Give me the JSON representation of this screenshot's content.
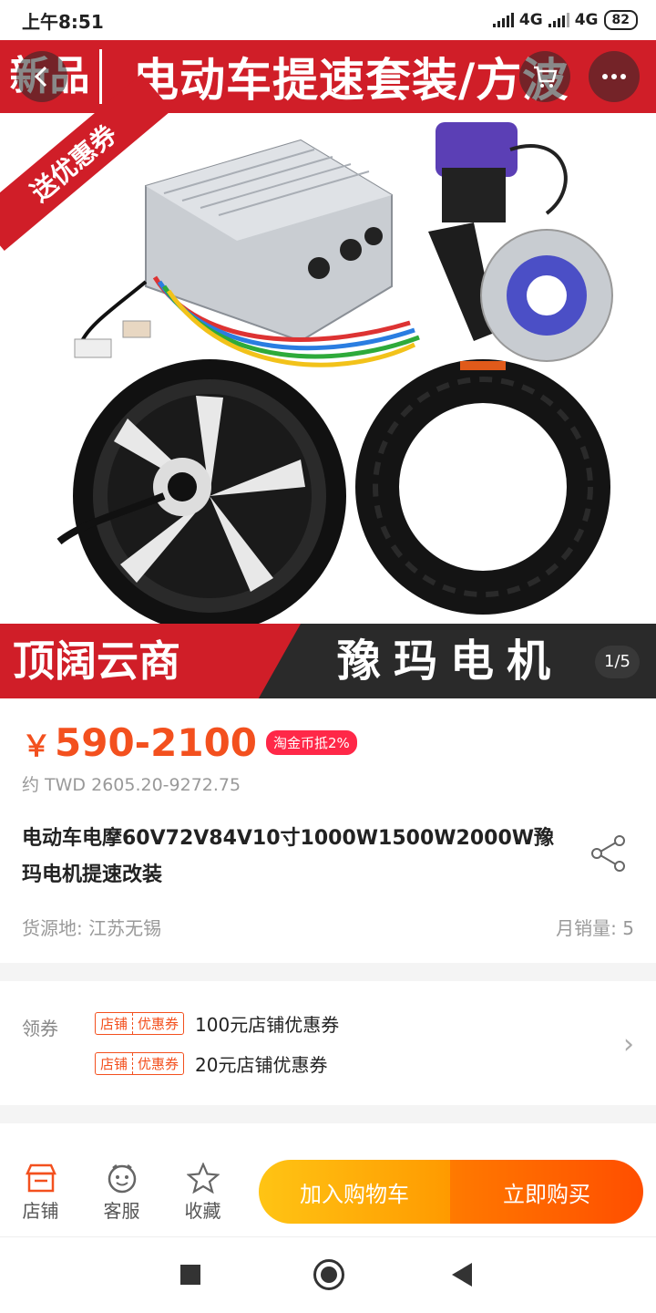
{
  "status_bar": {
    "time": "上午8:51",
    "network_1": "4G",
    "network_2": "4G",
    "battery": "82"
  },
  "hero": {
    "tag_new": "新品",
    "banner_title": "电动车提速套装/方波",
    "coupon_ribbon": "送优惠券",
    "shop_name": "顶阔云商",
    "brand_name": "豫玛电机",
    "page_indicator": "1/5",
    "product_image_label": "product photo: controller, brake disc, hub motor, tire"
  },
  "product": {
    "currency": "￥",
    "price": "590-2100",
    "price_badge": "淘金币抵2%",
    "twd": "约 TWD 2605.20-9272.75",
    "title": "电动车电摩60V72V84V10寸1000W1500W2000W豫玛电机提速改装",
    "origin": "货源地: 江苏无锡",
    "monthly_sales": "月销量: 5"
  },
  "coupons": {
    "label": "领券",
    "tag_left": "店铺",
    "tag_right": "优惠券",
    "items": [
      {
        "text": "100元店铺优惠券"
      },
      {
        "text": "20元店铺优惠券"
      }
    ]
  },
  "actions": {
    "shop": "店铺",
    "service": "客服",
    "favorite": "收藏",
    "add_to_cart": "加入购物车",
    "buy_now": "立即购买"
  },
  "colors": {
    "brand_red": "#d01e28",
    "price_orange": "#f3501e",
    "cart_yellow": "#ffc414",
    "buy_orange": "#ff4e00"
  }
}
